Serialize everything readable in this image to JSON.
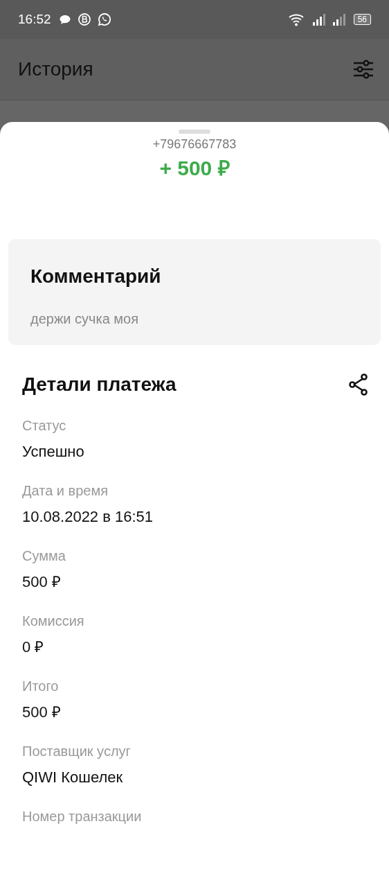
{
  "status_bar": {
    "time": "16:52",
    "battery": "56"
  },
  "header": {
    "title": "История"
  },
  "sheet": {
    "phone": "+79676667783",
    "amount": "+ 500 ₽"
  },
  "comment": {
    "title": "Комментарий",
    "text": "держи сучка моя"
  },
  "details": {
    "title": "Детали платежа",
    "items": [
      {
        "label": "Статус",
        "value": "Успешно"
      },
      {
        "label": "Дата и время",
        "value": "10.08.2022 в 16:51"
      },
      {
        "label": "Сумма",
        "value": "500 ₽"
      },
      {
        "label": "Комиссия",
        "value": "0 ₽"
      },
      {
        "label": "Итого",
        "value": "500 ₽"
      },
      {
        "label": "Поставщик услуг",
        "value": "QIWI Кошелек"
      },
      {
        "label": "Номер транзакции"
      }
    ]
  }
}
